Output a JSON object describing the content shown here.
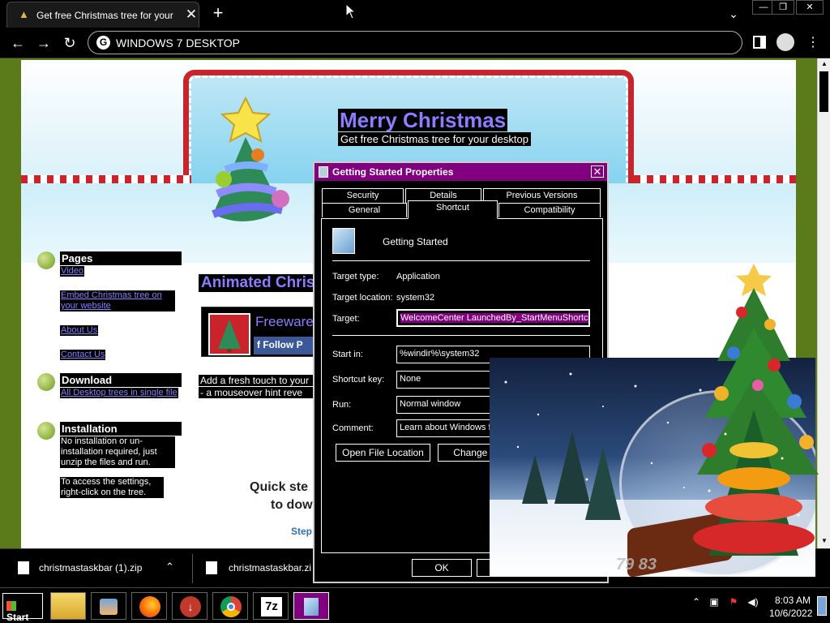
{
  "browser": {
    "tab_title": "Get free Christmas tree for your desktop",
    "tab_close": "✕",
    "new_tab": "+",
    "address": "WINDOWS 7 DESKTOP",
    "google_glyph": "G",
    "window_controls": [
      "—",
      "❐",
      "✕"
    ]
  },
  "site": {
    "title": "Merry Christmas",
    "subtitle": "Get free Christmas tree for your desktop",
    "sidebar": {
      "pages_heading": "Pages",
      "pages_links": [
        "Video",
        "Embed Christmas tree on your website",
        "About Us",
        "Contact Us"
      ],
      "download_heading": "Download",
      "download_link": "All Desktop trees in single file",
      "install_heading": "Installation",
      "install_text1": "No installation or un-installation required, just unzip the files and run.",
      "install_text2": "To access the settings, right-click on the tree."
    },
    "animated_heading": "Animated Christmas",
    "freeware_text": "Freeware",
    "follow_text": "f  Follow P",
    "desc_line1": "Add a fresh touch to your",
    "desc_line2": "- a mouseover hint reve",
    "quick_line1": "Quick ste",
    "quick_line2": "to dow",
    "step_link": "Step"
  },
  "downloads": {
    "items": [
      "christmastaskbar (1).zip",
      "christmastaskbar.zi"
    ],
    "chevron": "⌃"
  },
  "dialog": {
    "title": "Getting Started Properties",
    "close": "✕",
    "tabs_row1": [
      "Security",
      "Details",
      "Previous Versions"
    ],
    "tabs_row2": [
      "General",
      "Shortcut",
      "Compatibility"
    ],
    "name": "Getting Started",
    "target_type_label": "Target type:",
    "target_type_value": "Application",
    "target_location_label": "Target location:",
    "target_location_value": "system32",
    "target_label": "Target:",
    "target_value": "WelcomeCenter LaunchedBy_StartMenuShortcut",
    "start_in_label": "Start in:",
    "start_in_value": "%windir%\\system32",
    "shortcut_key_label": "Shortcut key:",
    "shortcut_key_value": "None",
    "run_label": "Run:",
    "run_value": "Normal window",
    "comment_label": "Comment:",
    "comment_value": "Learn about Windows fe",
    "open_file_location": "Open File Location",
    "change_icon": "Change Ico",
    "ok": "OK"
  },
  "gadget": {
    "digits": "79 83"
  },
  "taskbar": {
    "start_label": "Start",
    "apps": [
      "file-explorer-icon",
      "media-player-icon",
      "firefox-icon",
      "download-manager-icon",
      "chrome-icon",
      "7zip-icon",
      "getting-started-icon"
    ],
    "seven_z": "7z",
    "time": "8:03 AM",
    "date": "10/6/2022"
  },
  "colors": {
    "page_bg": "#5b7a1a",
    "dialog_title": "#800080",
    "link": "#8a7dff",
    "banner_red": "#c9242b"
  }
}
